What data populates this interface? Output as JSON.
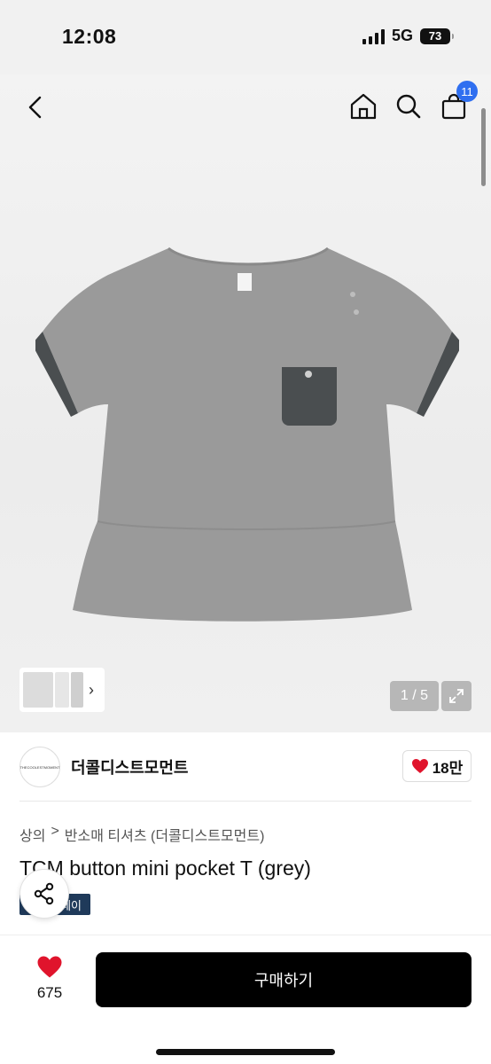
{
  "status_bar": {
    "time": "12:08",
    "network": "5G",
    "battery": "73"
  },
  "header": {
    "cart_count": "11",
    "icons": [
      "back-icon",
      "home-icon",
      "search-icon",
      "bag-icon"
    ]
  },
  "gallery": {
    "pager": "1 / 5",
    "thumb_arrow": "›"
  },
  "shop": {
    "logo_text": "THECOOLESTMOMENT",
    "name": "더콜디스트모먼트",
    "likes": "18만"
  },
  "breadcrumb": {
    "level1": "상의",
    "separator": ">",
    "level2": "반소매 티셔츠 (더콜디스트모먼트)"
  },
  "product": {
    "title": "TCM button mini pocket T (grey)",
    "tag": "페이"
  },
  "bottom": {
    "wish_count": "675",
    "buy_label": "구매하기"
  },
  "colors": {
    "accent_badge": "#2f6ff0",
    "heart": "#e0142c",
    "tag_bg": "#1f3a5a"
  }
}
